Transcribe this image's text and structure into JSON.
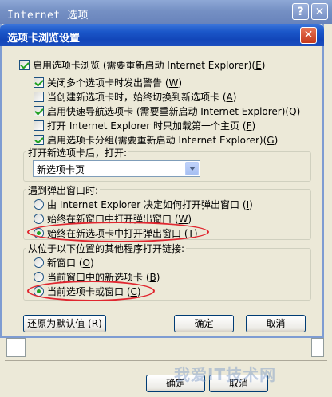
{
  "back_window": {
    "title": "Internet 选项",
    "help_glyph": "?",
    "close_glyph": "✕",
    "ok_label": "确定",
    "cancel_label": "取消"
  },
  "dialog": {
    "title": "选项卡浏览设置",
    "close_glyph": "✕",
    "enable_tabs": {
      "label": "启用选项卡浏览 (需要重新启动 Internet Explorer)(",
      "key": "E",
      "end": ")",
      "checked": true
    },
    "options": [
      {
        "label": "关闭多个选项卡时发出警告 (",
        "key": "W",
        "end": ")",
        "checked": true
      },
      {
        "label": "当创建新选项卡时，始终切换到新选项卡 (",
        "key": "A",
        "end": ")",
        "checked": false
      },
      {
        "label": "启用快速导航选项卡 (需要重新启动 Internet Explorer)(",
        "key": "Q",
        "end": ")",
        "checked": true
      },
      {
        "label": "打开 Internet Explorer 时只加载第一个主页 (",
        "key": "F",
        "end": ")",
        "checked": false
      },
      {
        "label": "启用选项卡分组(需要重新启动 Internet Explorer)(",
        "key": "G",
        "end": ")",
        "checked": true
      }
    ],
    "new_tab_group": {
      "legend": "打开新选项卡后，打开:",
      "selected": "新选项卡页"
    },
    "popup_group": {
      "legend": "遇到弹出窗口时:",
      "options": [
        {
          "label": "由 Internet Explorer 决定如何打开弹出窗口 (",
          "key": "I",
          "end": ")",
          "selected": false
        },
        {
          "label": "始终在新窗口中打开弹出窗口 (",
          "key": "W",
          "end": ")",
          "selected": false
        },
        {
          "label": "始终在新选项卡中打开弹出窗口 (",
          "key": "T",
          "end": ")",
          "selected": true
        }
      ]
    },
    "links_group": {
      "legend": "从位于以下位置的其他程序打开链接:",
      "options": [
        {
          "label": "新窗口 (",
          "key": "O",
          "end": ")",
          "selected": false
        },
        {
          "label": "当前窗口中的新选项卡 (",
          "key": "B",
          "end": ")",
          "selected": false
        },
        {
          "label": "当前选项卡或窗口 (",
          "key": "C",
          "end": ")",
          "selected": true
        }
      ]
    },
    "restore_label": "还原为默认值 (",
    "restore_key": "R",
    "restore_end": ")",
    "ok_label": "确定",
    "cancel_label": "取消"
  },
  "watermark": "我爱IT技术网",
  "colors": {
    "highlight": "#e0262f",
    "title_blue": "#1b57c9",
    "dialog_bg": "#ece9d8"
  }
}
